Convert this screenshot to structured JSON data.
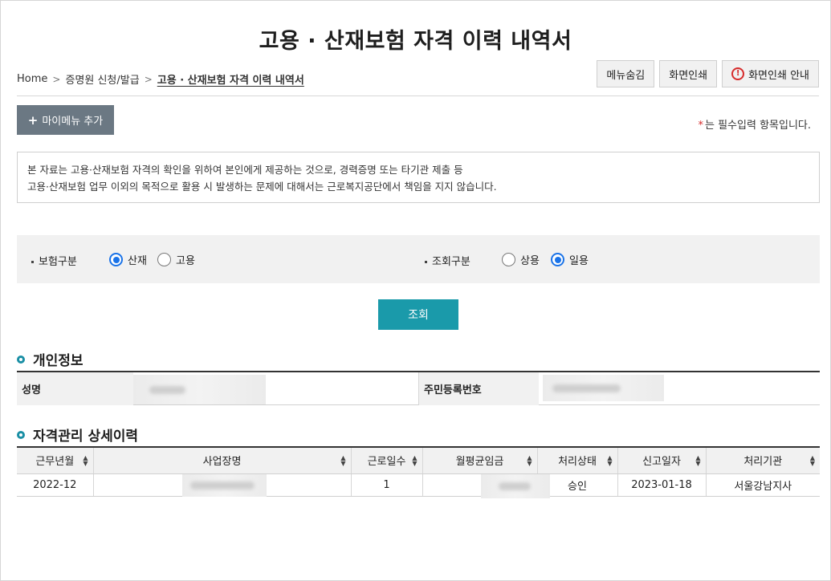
{
  "page_title": "고용 · 산재보험 자격 이력 내역서",
  "breadcrumb": {
    "home": "Home",
    "level1": "증명원 신청/발급",
    "current": "고용 · 산재보험 자격 이력 내역서"
  },
  "top_buttons": {
    "hide_menu": "메뉴숨김",
    "print": "화면인쇄",
    "print_guide": "화면인쇄 안내"
  },
  "mymenu_add": "마이메뉴 추가",
  "required_note": "는 필수입력 항목입니다.",
  "required_star": "*",
  "notice": {
    "line1": "본 자료는 고용·산재보험 자격의 확인을 위하여 본인에게 제공하는 것으로, 경력증명 또는 타기관 제출 등",
    "line2": "고용·산재보험 업무 이외의 목적으로 활용 시 발생하는 문제에 대해서는 근로복지공단에서 책임을 지지 않습니다."
  },
  "search": {
    "insurance_label": "보험구분",
    "insurance_options": [
      {
        "label": "산재",
        "selected": true
      },
      {
        "label": "고용",
        "selected": false
      }
    ],
    "query_label": "조회구분",
    "query_options": [
      {
        "label": "상용",
        "selected": false
      },
      {
        "label": "일용",
        "selected": true
      }
    ],
    "button": "조회"
  },
  "personal": {
    "title": "개인정보",
    "name_label": "성명",
    "rrn_label": "주민등록번호"
  },
  "history": {
    "title": "자격관리 상세이력",
    "columns": [
      "근무년월",
      "사업장명",
      "근로일수",
      "월평균임금",
      "처리상태",
      "신고일자",
      "처리기관"
    ],
    "rows": [
      {
        "month": "2022-12",
        "workplace": "",
        "days": "1",
        "wage": "",
        "status": "승인",
        "date": "2023-01-18",
        "office": "서울강남지사"
      }
    ]
  },
  "colors": {
    "accent": "#1a9aaa",
    "radio": "#1a73e8",
    "mymenu": "#6b7883",
    "warn": "#d62b2b"
  }
}
